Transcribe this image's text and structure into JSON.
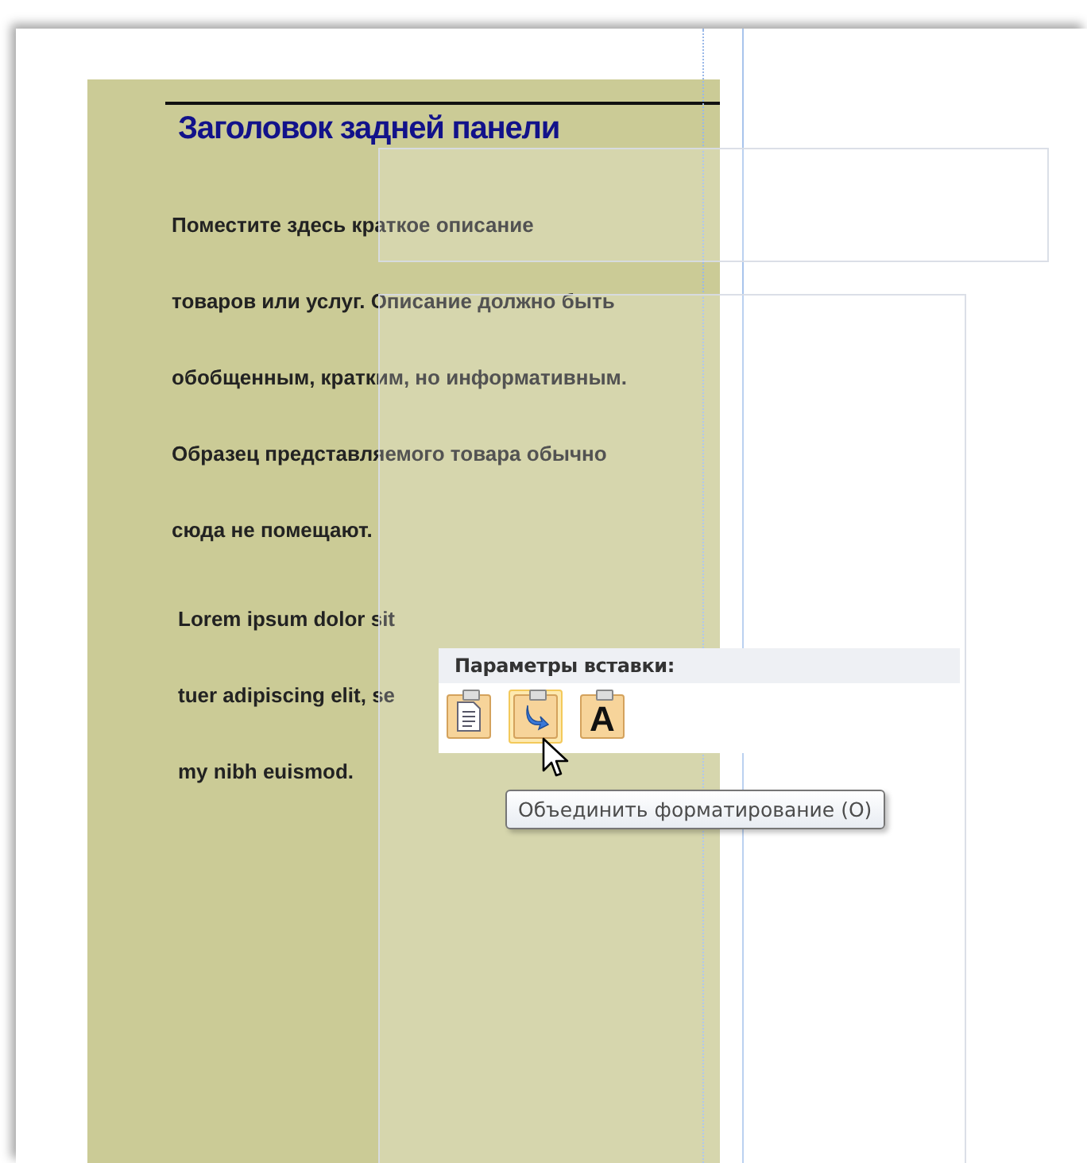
{
  "panel": {
    "heading": "Заголовок задней панели",
    "paragraphs": [
      {
        "lines": [
          "Поместите здесь краткое описание",
          "товаров или услуг. Описание должно быть",
          "обобщенным, кратким, но информативным.",
          "Образец представляемого товара обычно",
          "сюда не помещают."
        ]
      },
      {
        "lines": [
          "Lorem ipsum dolor sit",
          "tuer adipiscing elit, se",
          "my nibh euismod."
        ]
      }
    ]
  },
  "paste_menu": {
    "title": "Параметры вставки:",
    "options": [
      {
        "kind": "source",
        "selected": false
      },
      {
        "kind": "merge",
        "selected": true
      },
      {
        "kind": "text",
        "label": "A",
        "selected": false
      }
    ]
  },
  "tooltip": "Объединить форматирование (О)"
}
